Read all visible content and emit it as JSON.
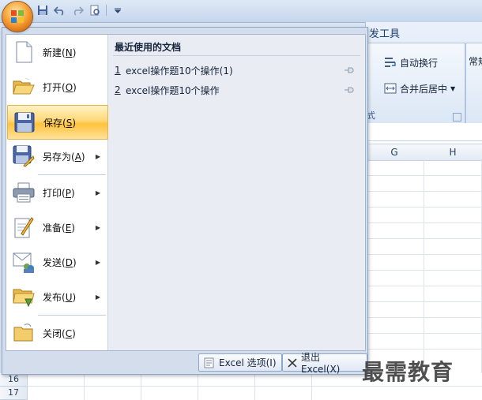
{
  "menu": {
    "items": [
      {
        "label": "新建",
        "key": "N",
        "name": "new",
        "arrow": false
      },
      {
        "label": "打开",
        "key": "O",
        "name": "open",
        "arrow": false
      },
      {
        "label": "保存",
        "key": "S",
        "name": "save",
        "arrow": false,
        "active": true
      },
      {
        "label": "另存为",
        "key": "A",
        "name": "save-as",
        "arrow": true
      },
      {
        "label": "打印",
        "key": "P",
        "name": "print",
        "arrow": true
      },
      {
        "label": "准备",
        "key": "E",
        "name": "prepare",
        "arrow": true
      },
      {
        "label": "发送",
        "key": "D",
        "name": "send",
        "arrow": true
      },
      {
        "label": "发布",
        "key": "U",
        "name": "publish",
        "arrow": true
      },
      {
        "label": "关闭",
        "key": "C",
        "name": "close",
        "arrow": false
      }
    ],
    "recent_title": "最近使用的文档",
    "recent": [
      {
        "num": "1",
        "name": "excel操作题10个操作(1)"
      },
      {
        "num": "2",
        "name": "excel操作题10个操作"
      }
    ],
    "options_label": "Excel 选项(I)",
    "exit_label": "退出 Excel(X)"
  },
  "ribbon": {
    "tab_fragment": "发工具",
    "wrap_text": "自动换行",
    "merge_center": "合并后居中",
    "group_fragment": "式",
    "number_fragment": "常规"
  },
  "sheet": {
    "columns": [
      "G",
      "H"
    ],
    "rows": [
      "16",
      "17"
    ]
  },
  "watermark": "最需教育",
  "arrow_glyph": "▶"
}
